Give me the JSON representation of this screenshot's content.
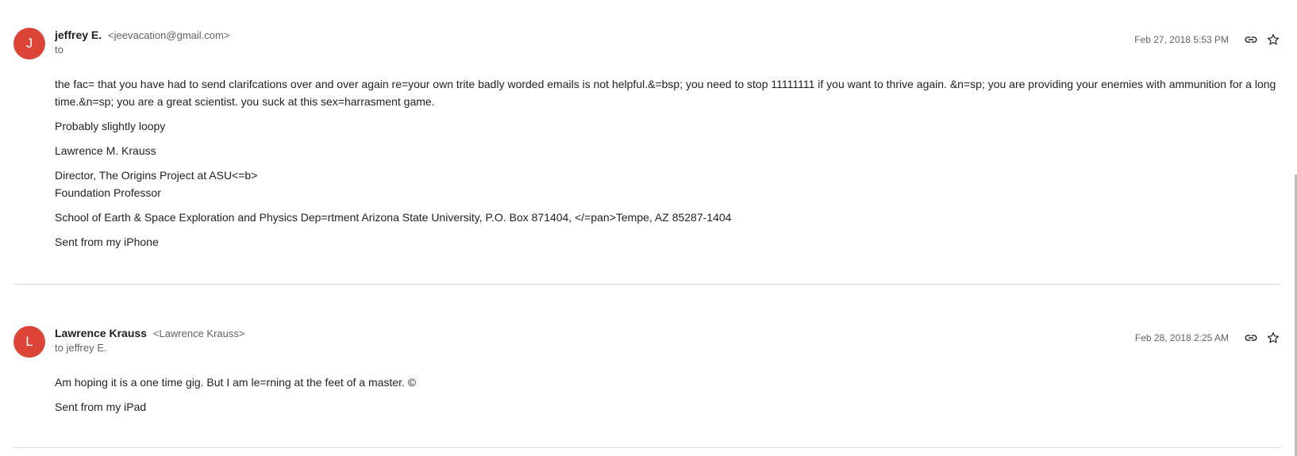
{
  "messages": [
    {
      "avatar_letter": "J",
      "sender_name": "jeffrey E.",
      "sender_email": "<jeevacation@gmail.com>",
      "recipient": "to",
      "date": "Feb 27, 2018 5:53 PM",
      "body": {
        "paragraph_1": "the fac= that you have had to send clarifcations over and over again re=your own trite badly worded emails is not helpful.&=bsp; you need to stop 11111111 if you want to thrive again. &n=sp; you are providing your enemies with ammunition for a long time.&n=sp; you are a great scientist. you suck at this sex=harrasment game.",
        "paragraph_2": "Probably slightly loopy",
        "paragraph_3": "Lawrence M. Krauss",
        "paragraph_4_line_1": "Director, The Origins Project at ASU<=b>",
        "paragraph_4_line_2": "Foundation Professor",
        "paragraph_5": "School of Earth & Space Exploration and Physics Dep=rtment Arizona State University, P.O. Box 871404, </=pan>Tempe, AZ 85287-1404",
        "paragraph_6": "Sent from my iPhone"
      }
    },
    {
      "avatar_letter": "L",
      "sender_name": "Lawrence Krauss",
      "sender_email": "<Lawrence Krauss>",
      "recipient": "to jeffrey E.",
      "date": "Feb 28, 2018 2:25 AM",
      "body": {
        "paragraph_1": "Am hoping it is a one time gig. But I am le=rning at the feet of a master. ©",
        "paragraph_2": "Sent from my iPad"
      }
    }
  ],
  "icons": {
    "link": "link-icon",
    "star": "star-icon"
  },
  "colors": {
    "avatar_bg": "#db4437",
    "secondary_text": "#5f6368",
    "divider": "#dadce0"
  }
}
